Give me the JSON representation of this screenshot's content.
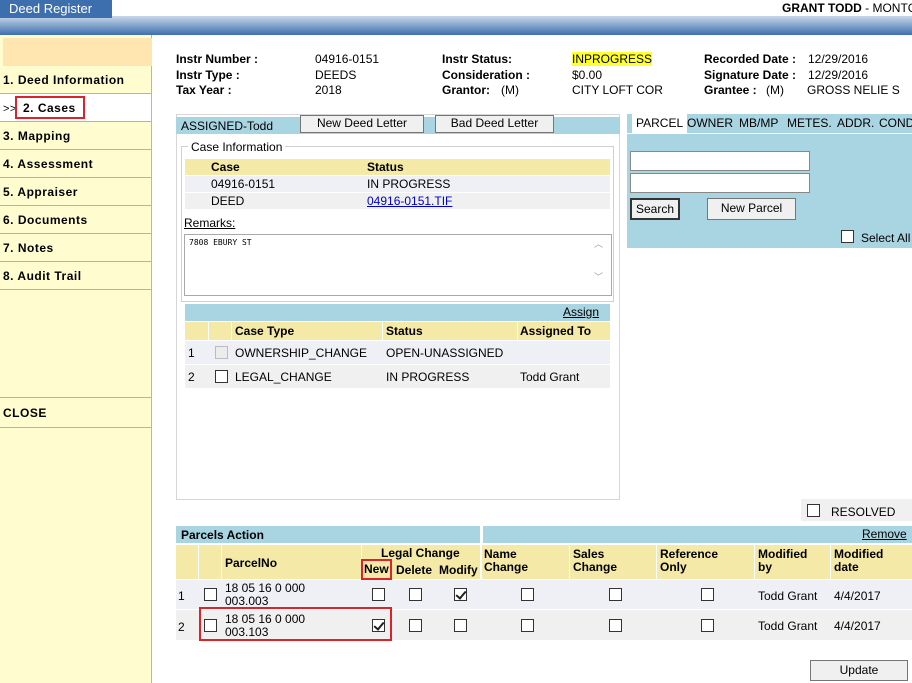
{
  "app": {
    "title": "Deed Register",
    "user_name": "GRANT TODD",
    "user_suffix": " - MONTG"
  },
  "sidebar": {
    "items": [
      {
        "label": "1. Deed Information"
      },
      {
        "prefix": ">>",
        "label": "2. Cases"
      },
      {
        "label": "3. Mapping"
      },
      {
        "label": "4. Assessment"
      },
      {
        "label": "5. Appraiser"
      },
      {
        "label": "6. Documents"
      },
      {
        "label": "7. Notes"
      },
      {
        "label": "8. Audit Trail"
      }
    ],
    "close_label": "CLOSE"
  },
  "header": {
    "instr_number_label": "Instr Number :",
    "instr_number": "04916-0151",
    "instr_type_label": "Instr Type :",
    "instr_type": "DEEDS",
    "tax_year_label": "Tax Year :",
    "tax_year": "2018",
    "instr_status_label": "Instr Status:",
    "instr_status": "INPROGRESS",
    "consideration_label": "Consideration :",
    "consideration": "$0.00",
    "grantor_label": "Grantor:",
    "grantor_type": "(M)",
    "grantor": "CITY LOFT COR",
    "recorded_date_label": "Recorded Date :",
    "recorded_date": "12/29/2016",
    "signature_date_label": "Signature Date :",
    "signature_date": "12/29/2016",
    "grantee_label": "Grantee :",
    "grantee_type": "(M)",
    "grantee": "GROSS NELIE S"
  },
  "case_panel": {
    "assigned": "ASSIGNED-Todd",
    "new_letter": "New Deed Letter",
    "bad_letter": "Bad Deed Letter",
    "legend": "Case Information",
    "col_case": "Case",
    "col_status": "Status",
    "rows": [
      {
        "case": "04916-0151",
        "status": "IN PROGRESS"
      },
      {
        "case": "DEED",
        "status": " 04916-0151.TIF"
      }
    ],
    "remarks_label": "Remarks:",
    "remarks": "7808 EBURY ST",
    "assign_link": "Assign",
    "type_headers": {
      "case_type": "Case Type",
      "status": "Status",
      "assigned_to": "Assigned To"
    },
    "types": [
      {
        "num": "1",
        "case_type": "OWNERSHIP_CHANGE",
        "status": "OPEN-UNASSIGNED",
        "assigned_to": ""
      },
      {
        "num": "2",
        "case_type": "LEGAL_CHANGE",
        "status": "IN PROGRESS",
        "assigned_to": "Todd Grant"
      }
    ]
  },
  "parcel_panel": {
    "tabs": [
      "PARCEL",
      "OWNER",
      "MB/MP",
      "METES.",
      "ADDR.",
      "COND"
    ],
    "search_btn": "Search",
    "new_parcel_btn": "New Parcel",
    "select_all": "Select All",
    "resolved": "RESOLVED"
  },
  "parcels": {
    "title": "Parcels Action",
    "remove": "Remove",
    "headers": {
      "parcel_no": "ParcelNo",
      "legal_change": "Legal Change",
      "new": "New",
      "delete": "Delete",
      "modify": "Modify",
      "name_change": "Name Change",
      "sales_change": "Sales Change",
      "reference_only": "Reference Only",
      "modified_by": "Modified by",
      "modified_date": "Modified date"
    },
    "rows": [
      {
        "num": "1",
        "parcel": "18 05 16 0 000 003.003",
        "modified_by": "Todd Grant",
        "modified_date": "4/4/2017"
      },
      {
        "num": "2",
        "parcel": "18 05 16 0 000 003.103",
        "modified_by": "Todd Grant",
        "modified_date": "4/4/2017"
      }
    ],
    "update_btn": "Update"
  }
}
